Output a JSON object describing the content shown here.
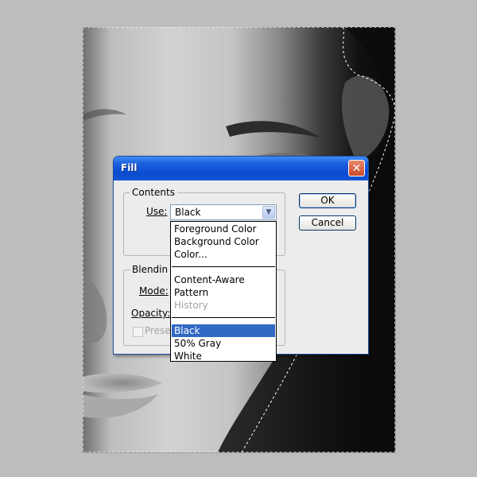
{
  "dialog": {
    "title": "Fill",
    "close_icon": "close-icon",
    "contents_legend": "Contents",
    "use_label": "Use:",
    "use_value": "Black",
    "blending_legend": "Blendin",
    "mode_label": "Mode:",
    "opacity_label": "Opacity:",
    "preserve_label": "Prese",
    "ok_label": "OK",
    "cancel_label": "Cancel"
  },
  "dropdown": {
    "options": [
      {
        "label": "Foreground Color",
        "state": "normal"
      },
      {
        "label": "Background Color",
        "state": "normal"
      },
      {
        "label": "Color...",
        "state": "normal"
      },
      {
        "label": "Content-Aware",
        "state": "normal"
      },
      {
        "label": "Pattern",
        "state": "normal"
      },
      {
        "label": "History",
        "state": "disabled"
      },
      {
        "label": "Black",
        "state": "selected"
      },
      {
        "label": "50% Gray",
        "state": "normal"
      },
      {
        "label": "White",
        "state": "normal"
      }
    ]
  },
  "colors": {
    "title_bar": "#0a4bd0",
    "selection_highlight": "#316ac5",
    "dialog_bg": "#ececec",
    "workspace_bg": "#bdbdbd"
  }
}
